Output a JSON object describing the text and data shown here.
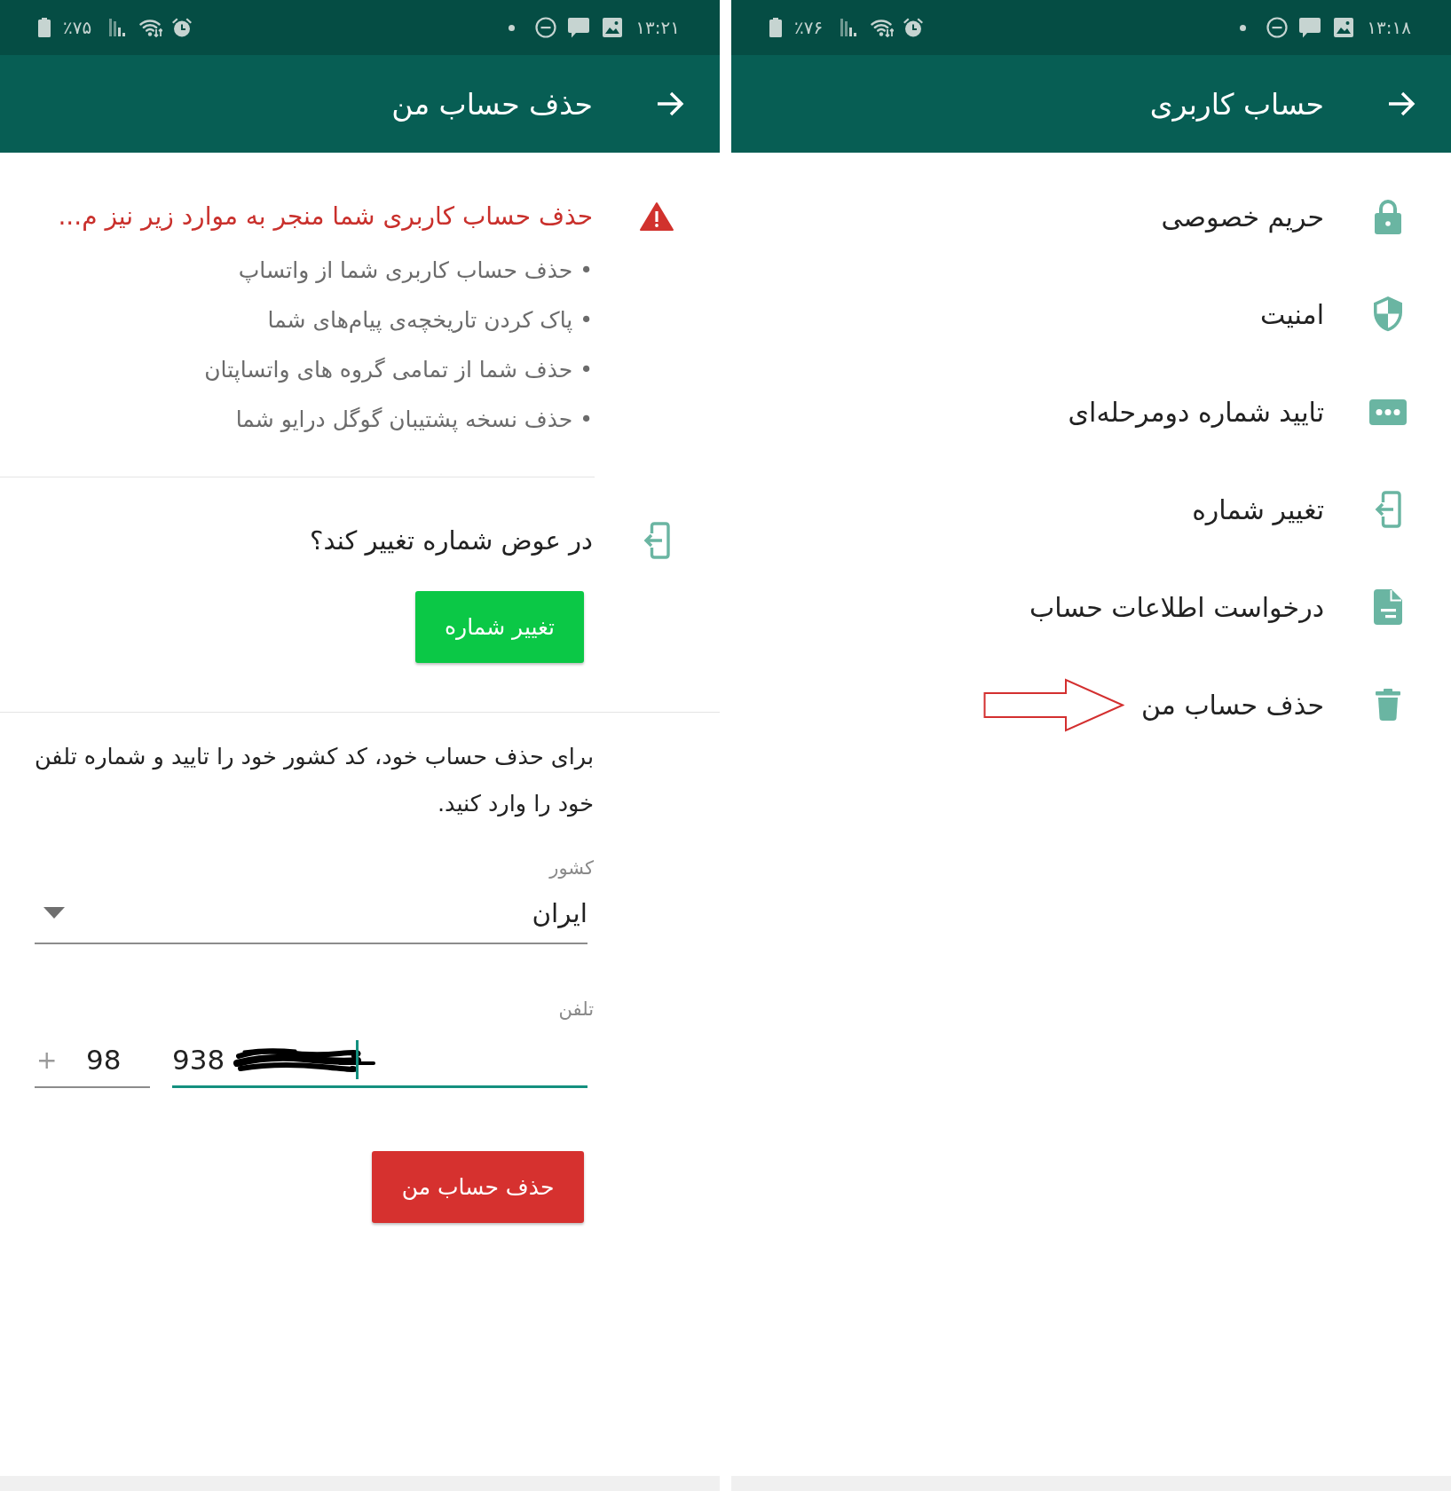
{
  "delete_account_screen": {
    "status_bar": {
      "battery": "٪۷۵",
      "time": "۱۳:۲۱"
    },
    "app_bar": {
      "title": "حذف حساب من"
    },
    "warning": {
      "title": "حذف حساب کاربری شما منجر به موارد زیر نیز م...",
      "items": [
        "• حذف حساب کاربری شما از واتساپ",
        "• پاک کردن تاریخچه‌ی پیام‌های شما",
        "• حذف شما از تمامی گروه های واتساپتان",
        "• حذف نسخه پشتیبان گوگل درایو شما"
      ]
    },
    "change_number": {
      "prompt": "در عوض شماره تغییر کند؟",
      "button": "تغییر شماره"
    },
    "instructions": "برای حذف حساب خود، کد کشور خود را تایید و شماره تلفن خود را وارد کنید.",
    "country": {
      "label": "کشور",
      "value": "ایران"
    },
    "phone": {
      "label": "تلفن",
      "prefix": "+",
      "country_code": "98",
      "number": "938",
      "focused": true
    },
    "delete_button": "حذف حساب من"
  },
  "account_screen": {
    "status_bar": {
      "battery": "٪۷۶",
      "time": "۱۳:۱۸"
    },
    "app_bar": {
      "title": "حساب کاربری"
    },
    "items": [
      {
        "label": "حریم خصوصی",
        "annotated": false
      },
      {
        "label": "امنیت",
        "annotated": false
      },
      {
        "label": "تایید شماره دومرحله‌ای",
        "annotated": false
      },
      {
        "label": "تغییر شماره",
        "annotated": false
      },
      {
        "label": "درخواست اطلاعات حساب",
        "annotated": false
      },
      {
        "label": "حذف حساب من",
        "annotated": true
      }
    ]
  }
}
